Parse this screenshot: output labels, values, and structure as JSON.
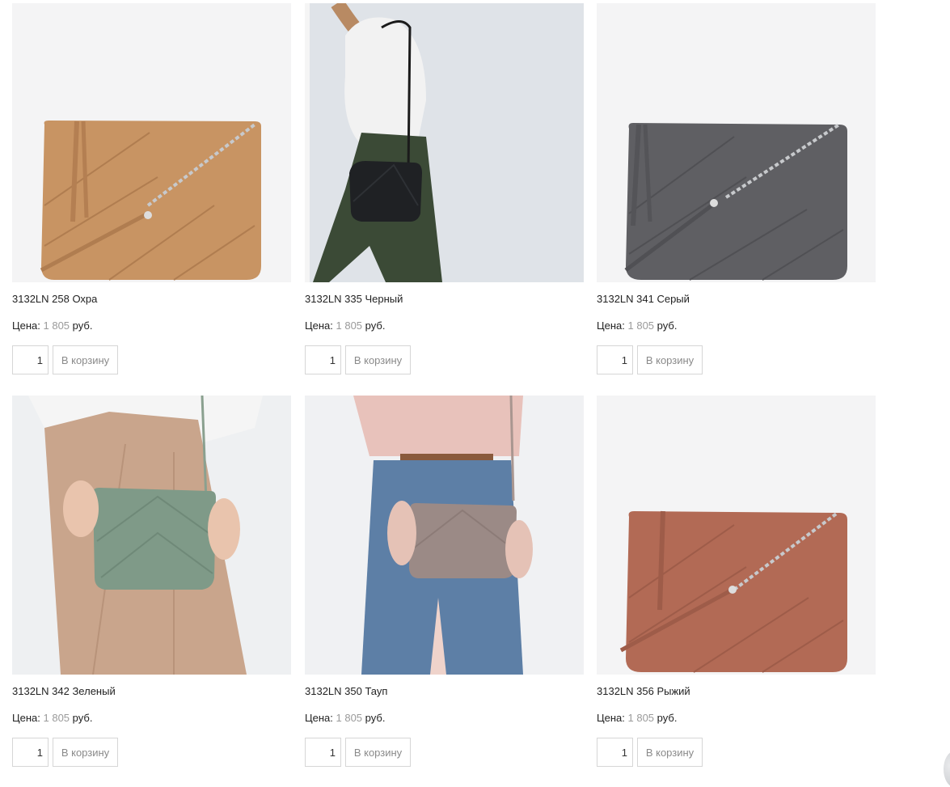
{
  "price_prefix": "Цена:",
  "currency": "руб.",
  "add_to_cart_label": "В корзину",
  "products": [
    {
      "title": "3132LN 258 Охра",
      "price": "1 805",
      "qty": "1",
      "bag_color": "#c89463",
      "photo": "bag-ochre-studio"
    },
    {
      "title": "3132LN 335 Черный",
      "price": "1 805",
      "qty": "1",
      "bag_color": "#1f2124",
      "photo": "model-black-bag"
    },
    {
      "title": "3132LN 341 Серый",
      "price": "1 805",
      "qty": "1",
      "bag_color": "#5f5f63",
      "photo": "bag-grey-studio"
    },
    {
      "title": "3132LN 342 Зеленый",
      "price": "1 805",
      "qty": "1",
      "bag_color": "#7f9a88",
      "photo": "model-green-bag"
    },
    {
      "title": "3132LN 350 Тауп",
      "price": "1 805",
      "qty": "1",
      "bag_color": "#9b8a86",
      "photo": "model-taupe-bag"
    },
    {
      "title": "3132LN 356 Рыжий",
      "price": "1 805",
      "qty": "1",
      "bag_color": "#b26a55",
      "photo": "bag-ginger-studio"
    }
  ]
}
